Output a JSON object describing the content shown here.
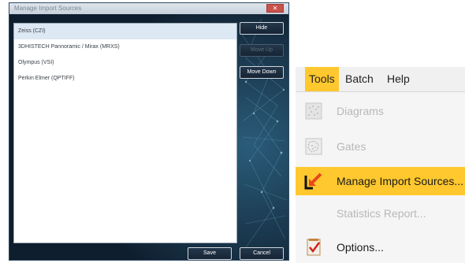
{
  "dialog": {
    "title": "Manage Import Sources",
    "close_label": "✕",
    "sources": [
      "Zeiss (CZI)",
      "3DHISTECH Pannoramic / Mirax (MRXS)",
      "Olympus (VSI)",
      "Perkin Elmer (QPTIFF)"
    ],
    "selected_index": 0,
    "buttons": {
      "hide": "Hide",
      "move_up": "Move Up",
      "move_down": "Move Down",
      "save": "Save",
      "cancel": "Cancel"
    }
  },
  "menu": {
    "menubar": [
      "Tools",
      "Batch",
      "Help"
    ],
    "active_menu": "Tools",
    "items": [
      {
        "label": "Diagrams",
        "icon": "diagrams-icon",
        "enabled": false
      },
      {
        "label": "Gates",
        "icon": "gates-icon",
        "enabled": false
      },
      {
        "label": "Manage Import Sources...",
        "icon": "import-arrow-icon",
        "enabled": true,
        "highlighted": true
      },
      {
        "label": "Statistics Report...",
        "icon": "none",
        "enabled": false
      },
      {
        "label": "Options...",
        "icon": "options-checklist-icon",
        "enabled": true
      }
    ]
  },
  "colors": {
    "highlight": "#ffc82e",
    "dialog_bg": "#14263a",
    "import_arrow": "#e8471c"
  }
}
